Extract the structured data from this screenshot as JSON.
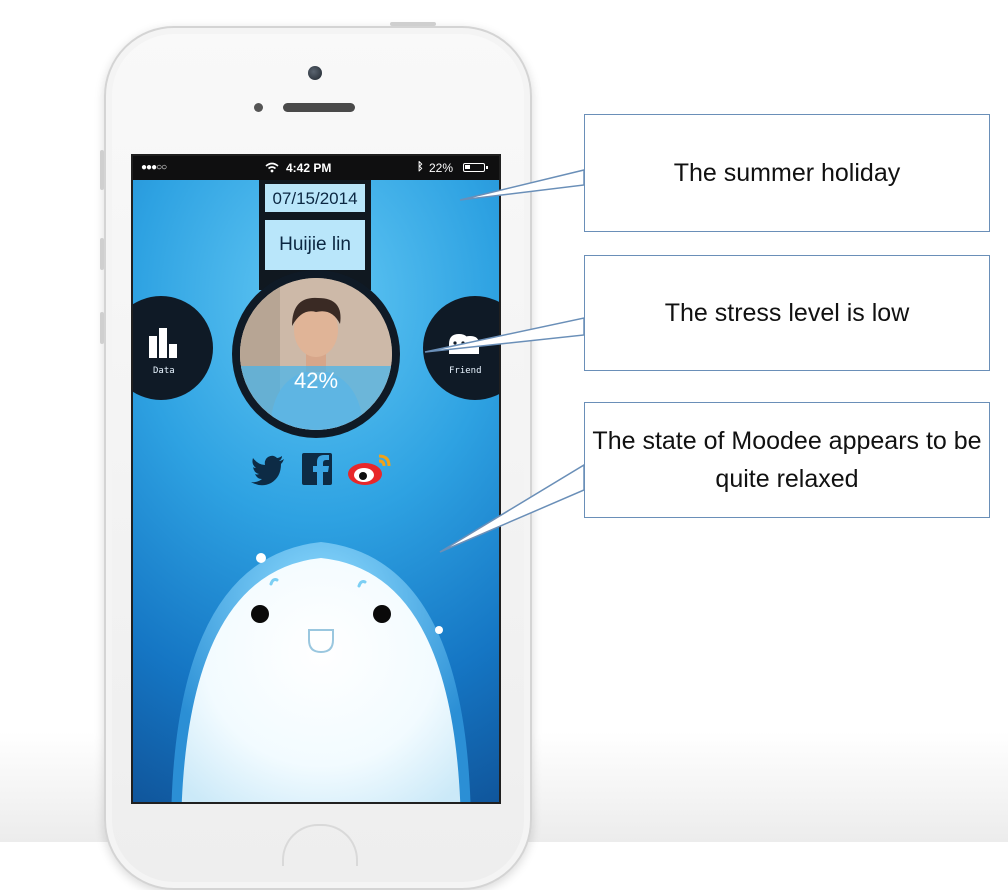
{
  "status_bar": {
    "carrier_signal": "●●●○○",
    "time": "4:42 PM",
    "battery": "22%",
    "icons": [
      "wifi-icon",
      "bluetooth-icon",
      "battery-icon"
    ]
  },
  "profile": {
    "date": "07/15/2014",
    "name": "Huijie lin",
    "stress_level": "42%",
    "stress_fraction": 0.42
  },
  "side_buttons": {
    "data_label": "Data",
    "friend_label": "Friend"
  },
  "social_icons": [
    "twitter-icon",
    "facebook-icon",
    "weibo-icon"
  ],
  "callouts": [
    {
      "text": "The summer holiday"
    },
    {
      "text": "The stress level is low"
    },
    {
      "text": "The state of Moodee appears to be quite relaxed"
    }
  ],
  "colors": {
    "screen_light": "#63c8f4",
    "screen_dark": "#0f4f93",
    "tag_bg": "#b9e6fa",
    "callout_border": "#6a8fb8"
  }
}
